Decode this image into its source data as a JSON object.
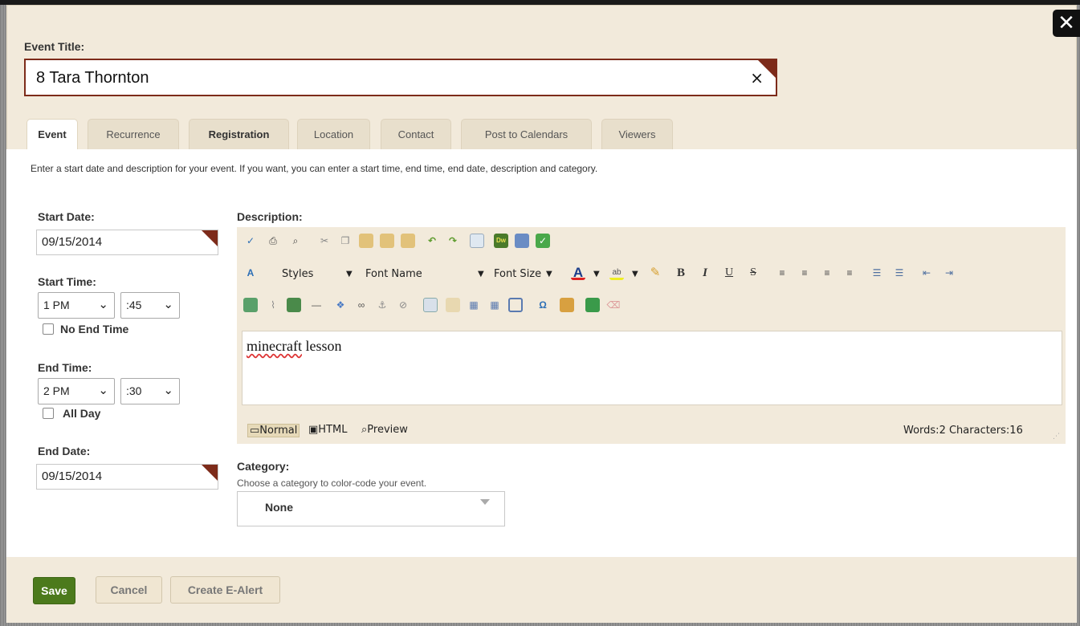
{
  "event_title": {
    "label": "Event Title:",
    "value": "8 Tara Thornton",
    "clear_icon": "×"
  },
  "tabs": [
    {
      "label": "Event",
      "active": true
    },
    {
      "label": "Recurrence",
      "active": false
    },
    {
      "label": "Registration",
      "active": false
    },
    {
      "label": "Location",
      "active": false
    },
    {
      "label": "Contact",
      "active": false
    },
    {
      "label": "Post to Calendars",
      "active": false
    },
    {
      "label": "Viewers",
      "active": false
    }
  ],
  "intro_text": "Enter a start date and description for your event. If you want, you can enter a start time, end time, end date, description and category.",
  "start_date": {
    "label": "Start Date:",
    "value": "09/15/2014"
  },
  "start_time": {
    "label": "Start Time:",
    "hour": "1 PM",
    "minute": ":45"
  },
  "no_end_time": {
    "label": "No End Time",
    "checked": false
  },
  "end_time": {
    "label": "End Time:",
    "hour": "2 PM",
    "minute": ":30"
  },
  "all_day": {
    "label": "All Day",
    "checked": false
  },
  "end_date": {
    "label": "End Date:",
    "value": "09/15/2014"
  },
  "description": {
    "label": "Description:",
    "toolbar": {
      "styles": "Styles",
      "font_name": "Font Name",
      "font_size": "Font Size"
    },
    "content_misspelled": "minecraft",
    "content_rest": " lesson",
    "modes": [
      "Normal",
      "HTML",
      "Preview"
    ],
    "word_count": "Words:2 Characters:16"
  },
  "category": {
    "label": "Category:",
    "hint": "Choose a category to color-code your event.",
    "selected": "None"
  },
  "buttons": {
    "save": "Save",
    "cancel": "Cancel",
    "create_alert": "Create E-Alert"
  },
  "close_icon": "✕",
  "colors": {
    "accent_red": "#7d2b1a",
    "save_green": "#4c7a1c",
    "panel_bg": "#f2eadb"
  }
}
